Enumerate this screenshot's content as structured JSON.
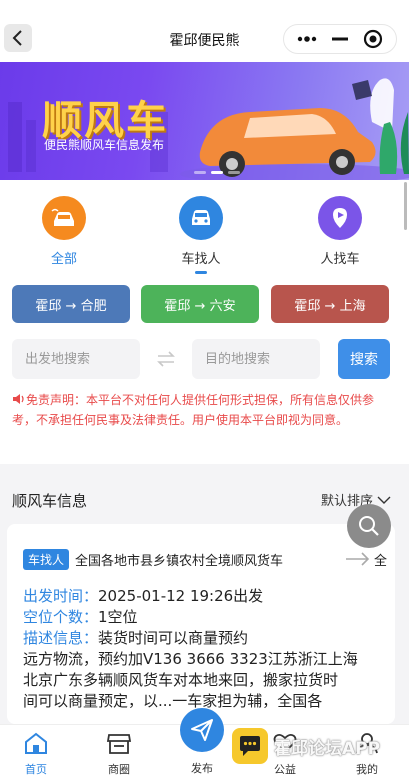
{
  "header": {
    "title": "霍邱便民熊"
  },
  "banner": {
    "title": "顺风车",
    "subtitle": "便民熊顺风车信息发布"
  },
  "categories": [
    {
      "label": "全部",
      "icon": "car-wave-icon",
      "color": "#f58a1f"
    },
    {
      "label": "车找人",
      "icon": "car-front-icon",
      "color": "#2f86e0"
    },
    {
      "label": "人找车",
      "icon": "flag-pin-icon",
      "color": "#7b55e8"
    }
  ],
  "routes": [
    {
      "label": "霍邱 → 合肥",
      "color": "#4d79b8"
    },
    {
      "label": "霍邱 → 六安",
      "color": "#4db35a"
    },
    {
      "label": "霍邱 → 上海",
      "color": "#b8554d"
    }
  ],
  "search": {
    "from_placeholder": "出发地搜索",
    "to_placeholder": "目的地搜索",
    "button": "搜索"
  },
  "disclaimer": "免责声明：本平台不对任何人提供任何形式担保，所有信息仅供参考，不承担任何民事及法律责任。用户使用本平台即视为同意。",
  "list": {
    "title": "顺风车信息",
    "sort": "默认排序"
  },
  "card": {
    "tag": "车找人",
    "route": "全国各地市县乡镇农村全境顺风货车",
    "dest": "全",
    "depart_label": "出发时间：",
    "depart_value": "2025-01-12 19:26出发",
    "seats_label": "空位个数：",
    "seats_value": "1空位",
    "desc_label": "描述信息：",
    "desc_value": "装货时间可以商量预约",
    "line2": "远方物流，预约加V136 3666 3323江苏浙江上海",
    "line3": "北京广东多辆顺风货车对本地来回，搬家拉货时",
    "line4": "间可以商量预定，以...一车家担为辅，全国各"
  },
  "tabbar": [
    {
      "label": "首页",
      "icon": "home-icon",
      "active": true
    },
    {
      "label": "商圈",
      "icon": "shop-icon",
      "active": false
    },
    {
      "label": "发布",
      "icon": "send-icon",
      "active": false
    },
    {
      "label": "公益",
      "icon": "heart-icon",
      "active": false
    },
    {
      "label": "我的",
      "icon": "user-icon",
      "active": false
    }
  ],
  "watermark": "霍邱论坛APP",
  "colors": {
    "accent": "#2f86e0",
    "danger": "#e84a4a",
    "search_button": "#3f8fe8"
  }
}
